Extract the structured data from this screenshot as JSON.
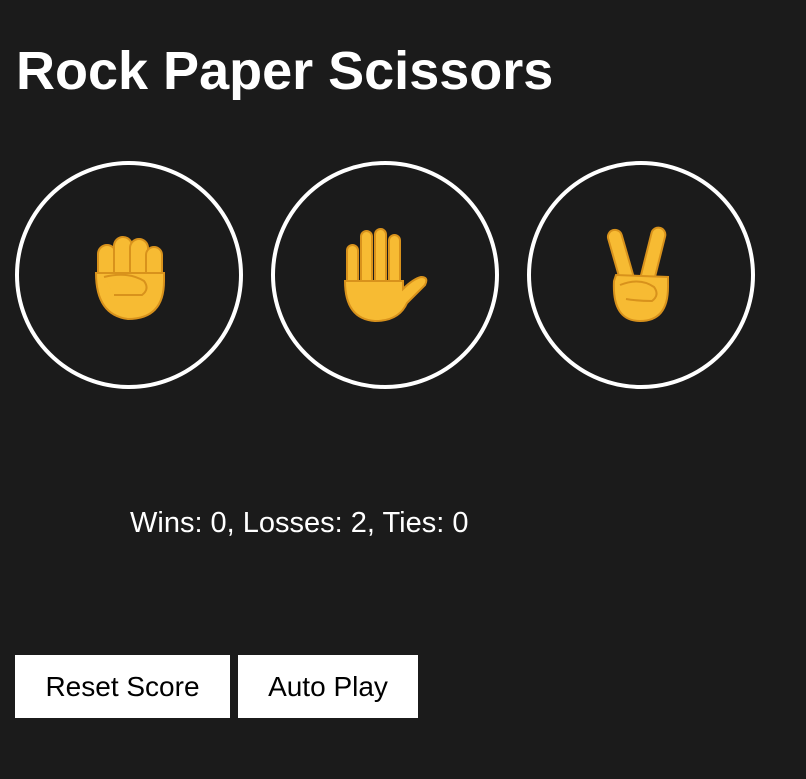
{
  "title": "Rock Paper Scissors",
  "moves": [
    {
      "name": "rock",
      "icon": "fist-emoji"
    },
    {
      "name": "paper",
      "icon": "raised-hand-emoji"
    },
    {
      "name": "scissors",
      "icon": "victory-hand-emoji"
    }
  ],
  "score": {
    "text": "Wins: 0, Losses: 2, Ties: 0",
    "wins": 0,
    "losses": 2,
    "ties": 0
  },
  "controls": {
    "reset_label": "Reset Score",
    "auto_play_label": "Auto Play"
  },
  "colors": {
    "background": "#1b1b1b",
    "text": "#ffffff",
    "emoji": "#f7bb33",
    "emoji_outline": "#e19b1f"
  }
}
